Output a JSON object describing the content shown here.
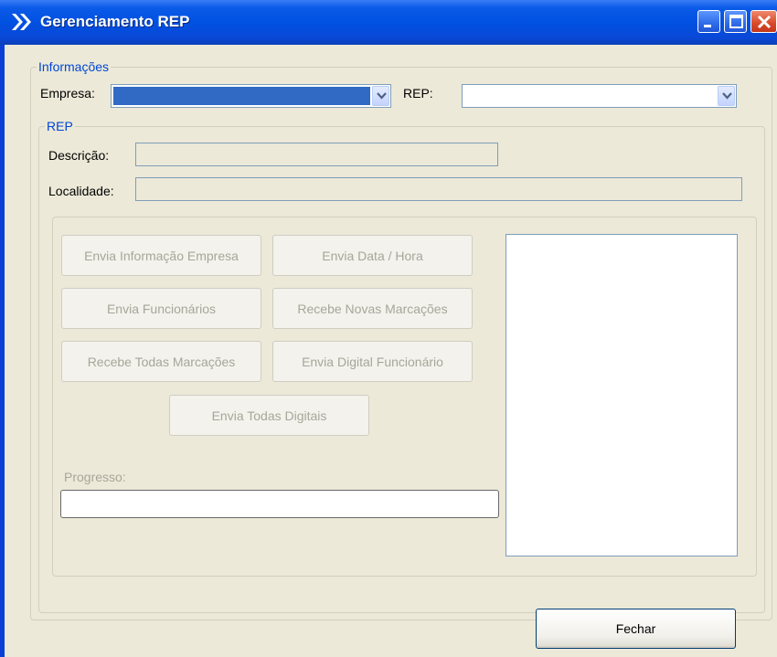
{
  "window": {
    "title": "Gerenciamento REP",
    "controls": [
      "minimize",
      "maximize",
      "close"
    ]
  },
  "colors": {
    "titlebar": "#0151e2",
    "group_title": "#0046d5",
    "selection": "#316ac5",
    "disabled_text": "#a7a69a"
  },
  "informacoes": {
    "title": "Informações",
    "empresa_label": "Empresa:",
    "empresa_value": "",
    "rep_label": "REP:",
    "rep_value": ""
  },
  "rep": {
    "title": "REP",
    "descricao_label": "Descrição:",
    "descricao_value": "",
    "localidade_label": "Localidade:",
    "localidade_value": ""
  },
  "actions": {
    "envia_informacao_empresa": "Envia Informação Empresa",
    "envia_data_hora": "Envia Data / Hora",
    "envia_funcionarios": "Envia Funcionários",
    "recebe_novas_marcacoes": "Recebe Novas Marcações",
    "recebe_todas_marcacoes": "Recebe Todas Marcações",
    "envia_digital_funcionario": "Envia Digital Funcionário",
    "envia_todas_digitais": "Envia Todas Digitais"
  },
  "progress": {
    "label": "Progresso:",
    "value": 0
  },
  "footer": {
    "fechar_label": "Fechar"
  }
}
